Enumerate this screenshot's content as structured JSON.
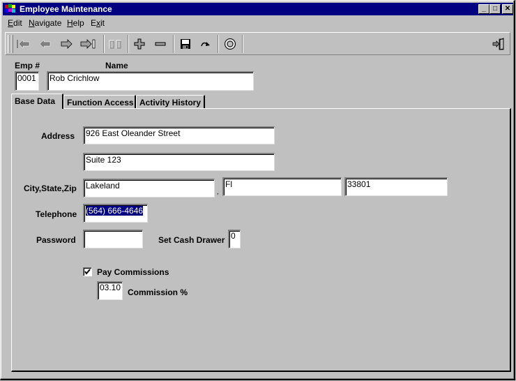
{
  "window": {
    "title": "Employee Maintenance",
    "controls": [
      "minimize",
      "maximize",
      "close"
    ]
  },
  "menu": [
    {
      "label": "Edit",
      "accel": "E"
    },
    {
      "label": "Navigate",
      "accel": "N"
    },
    {
      "label": "Help",
      "accel": "H"
    },
    {
      "label": "Exit",
      "accel": "x"
    }
  ],
  "toolbar": {
    "buttons": [
      {
        "name": "first-record",
        "icon": "first-icon",
        "enabled": false
      },
      {
        "name": "previous-record",
        "icon": "arrow-left-icon",
        "enabled": false
      },
      {
        "name": "next-record",
        "icon": "arrow-right-icon",
        "enabled": true
      },
      {
        "name": "last-record",
        "icon": "last-icon",
        "enabled": true
      },
      {
        "name": "find",
        "icon": "binoculars-icon",
        "enabled": false
      },
      {
        "name": "add",
        "icon": "plus-icon",
        "enabled": true
      },
      {
        "name": "delete",
        "icon": "minus-icon",
        "enabled": true
      },
      {
        "name": "save",
        "icon": "floppy-disk-icon",
        "enabled": true
      },
      {
        "name": "redo",
        "icon": "redo-icon",
        "enabled": true
      },
      {
        "name": "help",
        "icon": "lifebuoy-icon",
        "enabled": true
      },
      {
        "name": "exit",
        "icon": "exit-door-icon",
        "enabled": true
      }
    ]
  },
  "header": {
    "emp_label": "Emp #",
    "emp_value": "0001",
    "name_label": "Name",
    "name_value": "Rob Crichlow"
  },
  "tabs": [
    {
      "label": "Base Data",
      "active": true
    },
    {
      "label": "Function Access",
      "active": false
    },
    {
      "label": "Activity History",
      "active": false
    }
  ],
  "base_data": {
    "address_label": "Address",
    "address1": "926 East Oleander Street",
    "address2": "Suite 123",
    "city_state_zip_label": "City,State,Zip",
    "city": "Lakeland",
    "state": "Fl",
    "zip": "33801",
    "telephone_label": "Telephone",
    "telephone": "(564) 666-4646",
    "password_label": "Password",
    "password": "",
    "cash_drawer_label": "Set Cash Drawer",
    "cash_drawer": "0",
    "pay_commissions_label": "Pay Commissions",
    "pay_commissions_checked": true,
    "commission_value": "03.10",
    "commission_label": "Commission %"
  }
}
